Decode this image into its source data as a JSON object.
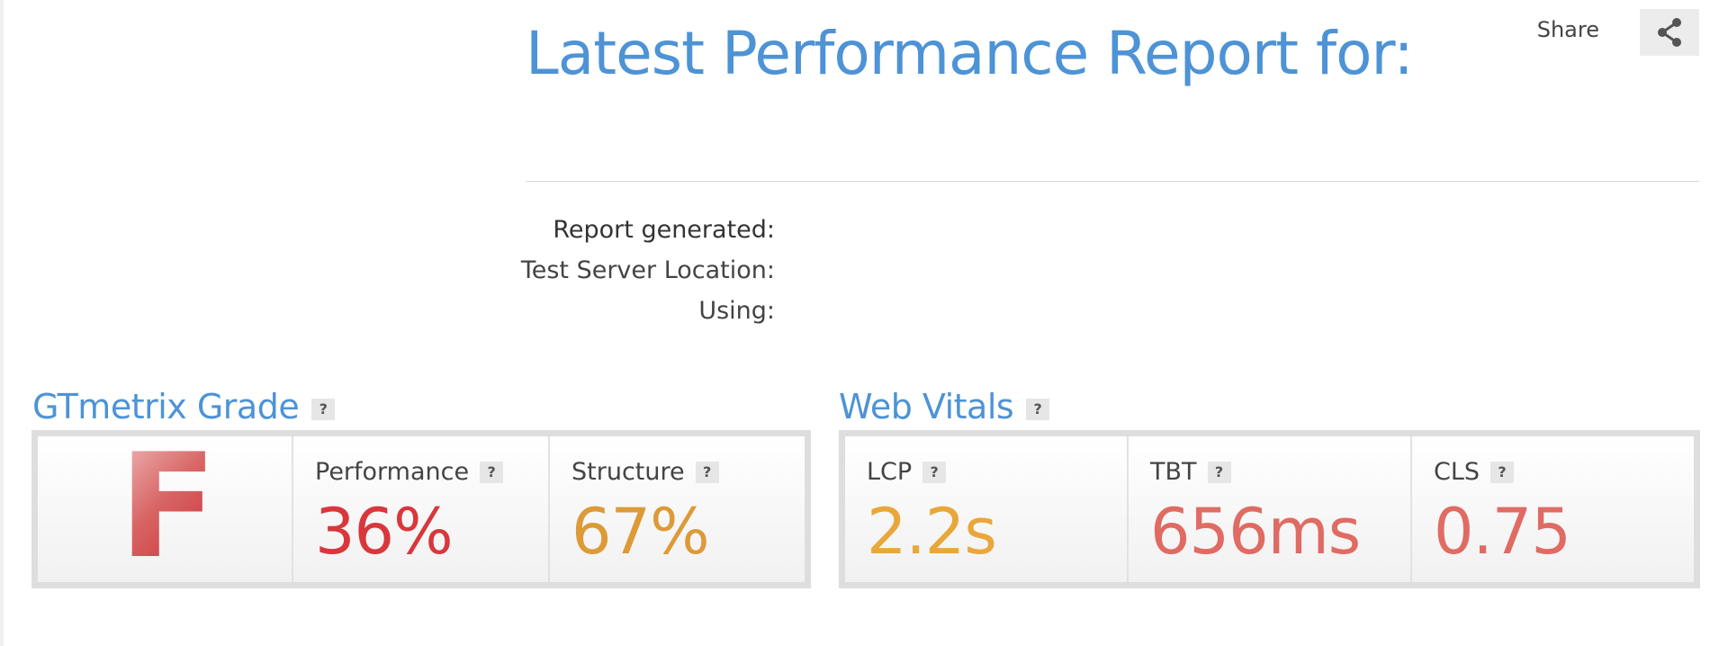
{
  "header": {
    "title": "Latest Performance Report for:",
    "share_label": "Share",
    "share_icon": "share-icon"
  },
  "meta": {
    "report_generated_label": "Report generated:",
    "test_server_label": "Test Server Location:",
    "using_label": "Using:"
  },
  "grade": {
    "title": "GTmetrix Grade",
    "help": "?",
    "letter": "F",
    "performance": {
      "label": "Performance",
      "help": "?",
      "value": "36%",
      "color": "#d8373c"
    },
    "structure": {
      "label": "Structure",
      "help": "?",
      "value": "67%",
      "color": "#dd9a38"
    }
  },
  "vitals": {
    "title": "Web Vitals",
    "help": "?",
    "lcp": {
      "label": "LCP",
      "help": "?",
      "value": "2.2s",
      "color": "#e9a73b"
    },
    "tbt": {
      "label": "TBT",
      "help": "?",
      "value": "656ms",
      "color": "#e06b63"
    },
    "cls": {
      "label": "CLS",
      "help": "?",
      "value": "0.75",
      "color": "#e06b63"
    }
  },
  "colors": {
    "accent": "#4d93d6",
    "grade_f": "#c8262b"
  }
}
